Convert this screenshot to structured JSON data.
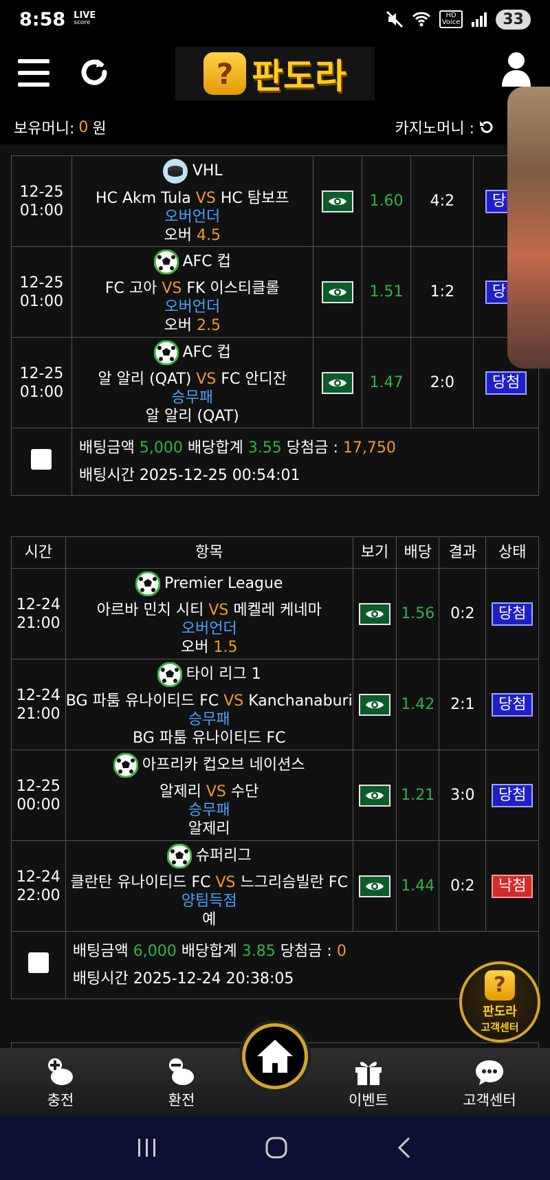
{
  "status_bar": {
    "time": "8:58",
    "live_top": "LIVE",
    "live_bottom": "score",
    "hd_top": "HD",
    "hd_bottom": "Voice",
    "battery": "33"
  },
  "header": {
    "logo_text": "판도라",
    "logo_badge": "?",
    "money_label": "보유머니:",
    "money_value": "0",
    "money_unit": "원",
    "casino_label": "카지노머니 :"
  },
  "slip1": {
    "matches": [
      {
        "date": "12-25",
        "time": "01:00",
        "league": "VHL",
        "league_icon": "hockey-puck-icon",
        "home": "HC Akm Tula",
        "vs": "VS",
        "away": "HC 탐보프",
        "market": "오버언더",
        "pick": "오버",
        "pick_value": "4.5",
        "odds": "1.60",
        "score": "4:2",
        "status": "당첨",
        "status_type": "win"
      },
      {
        "date": "12-25",
        "time": "01:00",
        "league": "AFC 컵",
        "league_icon": "soccer-ball-icon",
        "home": "FC 고아",
        "vs": "VS",
        "away": "FK 이스티클롤",
        "market": "오버언더",
        "pick": "오버",
        "pick_value": "2.5",
        "odds": "1.51",
        "score": "1:2",
        "status": "당첨",
        "status_type": "win"
      },
      {
        "date": "12-25",
        "time": "01:00",
        "league": "AFC 컵",
        "league_icon": "soccer-ball-icon",
        "home": "알 알리 (QAT)",
        "vs": "VS",
        "away": "FC 안디잔",
        "market": "승무패",
        "pick": "알 알리 (QAT)",
        "pick_value": "",
        "odds": "1.47",
        "score": "2:0",
        "status": "당첨",
        "status_type": "win"
      }
    ],
    "summary": {
      "bet_label": "배팅금액",
      "bet_amount": "5,000",
      "odds_label": "배당합계",
      "odds_total": "3.55",
      "win_label": "당첨금 :",
      "win_amount": "17,750",
      "time_label": "배팅시간",
      "time_value": "2025-12-25 00:54:01"
    }
  },
  "slip2": {
    "headers": {
      "time": "시간",
      "item": "항목",
      "view": "보기",
      "odds": "배당",
      "result": "결과",
      "status": "상태"
    },
    "matches": [
      {
        "date": "12-24",
        "time": "21:00",
        "league": "Premier League",
        "home": "아르바 민치 시티",
        "vs": "VS",
        "away": "메켈레 케네마",
        "market": "오버언더",
        "pick": "오버",
        "pick_value": "1.5",
        "odds": "1.56",
        "score": "0:2",
        "status": "당첨",
        "status_type": "win"
      },
      {
        "date": "12-24",
        "time": "21:00",
        "league": "타이 리그 1",
        "home": "BG 파툼 유나이티드 FC",
        "vs": "VS",
        "away": "Kanchanaburi",
        "market": "승무패",
        "pick": "BG 파툼 유나이티드 FC",
        "pick_value": "",
        "odds": "1.42",
        "score": "2:1",
        "status": "당첨",
        "status_type": "win"
      },
      {
        "date": "12-25",
        "time": "00:00",
        "league": "아프리카 컵오브 네이션스",
        "home": "알제리",
        "vs": "VS",
        "away": "수단",
        "market": "승무패",
        "pick": "알제리",
        "pick_value": "",
        "odds": "1.21",
        "score": "3:0",
        "status": "당첨",
        "status_type": "win"
      },
      {
        "date": "12-24",
        "time": "22:00",
        "league": "슈퍼리그",
        "home": "클란탄 유나이티드 FC",
        "vs": "VS",
        "away": "느그리슴빌란 FC",
        "market": "양팀득점",
        "pick": "예",
        "pick_value": "",
        "odds": "1.44",
        "score": "0:2",
        "status": "낙첨",
        "status_type": "lose"
      }
    ],
    "summary": {
      "bet_label": "배팅금액",
      "bet_amount": "6,000",
      "odds_label": "배당합계",
      "odds_total": "3.85",
      "win_label": "당첨금 :",
      "win_amount": "0",
      "time_label": "배팅시간",
      "time_value": "2025-12-24 20:38:05"
    }
  },
  "customer_center_float": {
    "line1": "판도라",
    "line2": "고객센터"
  },
  "bottom_nav": {
    "charge": "충전",
    "exchange": "환전",
    "events": "이벤트",
    "support": "고객센터"
  }
}
